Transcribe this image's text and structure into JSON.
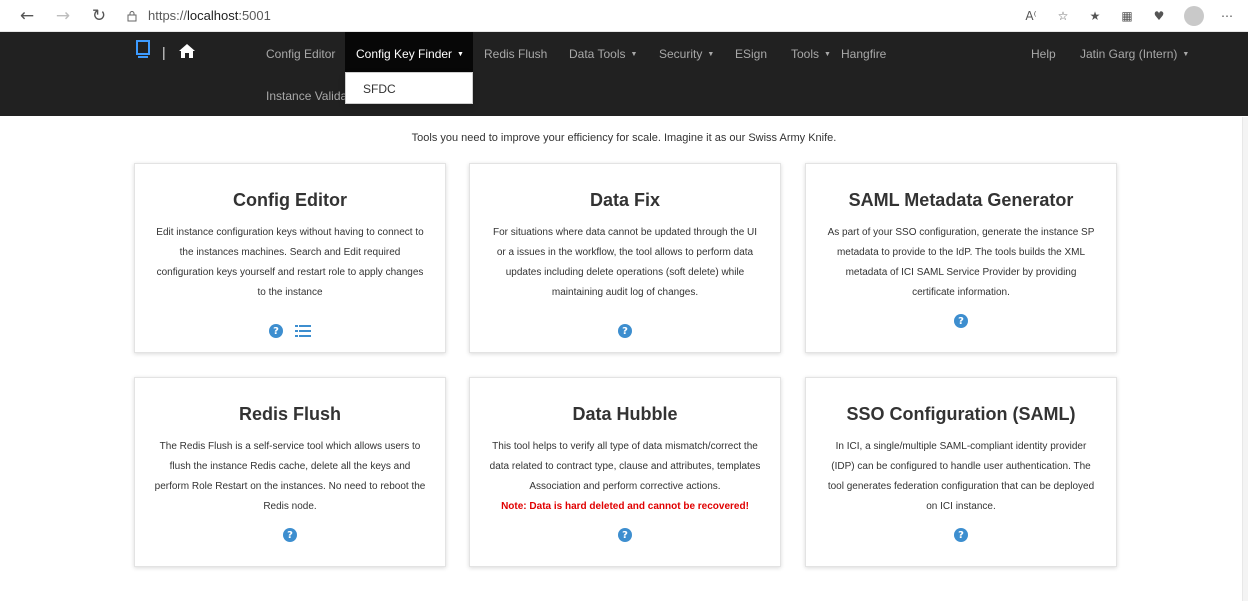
{
  "browser": {
    "url_prefix": "https://",
    "url_host": "localhost",
    "url_port": ":5001",
    "icons": [
      "read-aloud-icon",
      "favorites-add-icon",
      "favorites-icon",
      "collections-icon",
      "health-icon",
      "profile-avatar",
      "more-icon"
    ]
  },
  "navbar": {
    "items": [
      {
        "label": "Config Editor"
      },
      {
        "label": "Config Key Finder",
        "active": true,
        "dropdown": true
      },
      {
        "label": "Redis Flush"
      },
      {
        "label": "Data Tools",
        "dropdown": true
      },
      {
        "label": "Security",
        "dropdown": true
      },
      {
        "label": "ESign"
      },
      {
        "label": "Tools",
        "dropdown": true
      },
      {
        "label": "Hangfire"
      },
      {
        "label": "Instance Valida"
      }
    ],
    "right": [
      {
        "label": "Help"
      },
      {
        "label": "Jatin Garg (Intern)",
        "dropdown": true
      }
    ],
    "dropdown_menu": [
      "SFDC"
    ]
  },
  "tagline": "Tools you need to improve your efficiency for scale. Imagine it as our Swiss Army Knife.",
  "cards": [
    {
      "title": "Config Editor",
      "description": "Edit instance configuration keys without having to connect to the instances machines. Search and Edit required configuration keys yourself and restart role to apply changes to the instance",
      "note": "",
      "icons": [
        "help-icon",
        "list-icon"
      ]
    },
    {
      "title": "Data Fix",
      "description": "For situations where data cannot be updated through the UI or a issues in the workflow, the tool allows to perform data updates including delete operations (soft delete) while maintaining audit log of changes.",
      "note": "",
      "icons": [
        "help-icon"
      ]
    },
    {
      "title": "SAML Metadata Generator",
      "description": "As part of your SSO configuration, generate the instance SP metadata to provide to the IdP. The tools builds the XML metadata of ICI SAML Service Provider by providing certificate information.",
      "note": "",
      "icons": [
        "help-icon"
      ]
    },
    {
      "title": "Redis Flush",
      "description": "The Redis Flush is a self-service tool which allows users to flush the instance Redis cache, delete all the keys and perform Role Restart on the instances. No need to reboot the Redis node.",
      "note": "",
      "icons": [
        "help-icon"
      ]
    },
    {
      "title": "Data Hubble",
      "description": "This tool helps to verify all type of data mismatch/correct the data related to contract type, clause and attributes, templates Association and perform corrective actions.",
      "note": "Note: Data is hard deleted and cannot be recovered!",
      "icons": [
        "help-icon"
      ]
    },
    {
      "title": "SSO Configuration (SAML)",
      "description": "In ICI, a single/multiple SAML-compliant identity provider (IDP) can be configured to handle user authentication. The tool generates federation configuration that can be deployed on ICI instance.",
      "note": "",
      "icons": [
        "help-icon"
      ]
    }
  ],
  "colors": {
    "navbar_bg": "#212121",
    "nav_text": "#a8a8a8",
    "accent_icon": "#3d8ecf",
    "note_red": "#e00000"
  }
}
